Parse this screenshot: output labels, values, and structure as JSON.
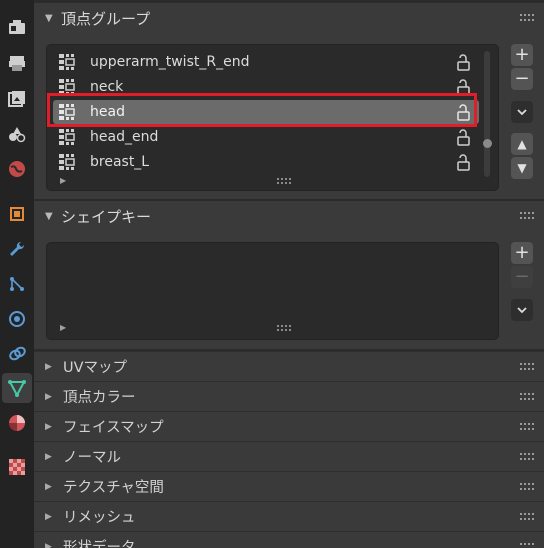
{
  "sidebar": {
    "tabs": [
      {
        "icon": "tool-icon",
        "active": false
      },
      {
        "icon": "render-icon",
        "active": false
      },
      {
        "icon": "output-icon",
        "active": false
      },
      {
        "icon": "view-layer-icon",
        "active": false
      },
      {
        "icon": "scene-icon",
        "active": false
      },
      {
        "icon": "world-icon",
        "active": false
      },
      {
        "icon": "object-icon",
        "active": false
      },
      {
        "icon": "modifier-wrench-icon",
        "active": false
      },
      {
        "icon": "particles-icon",
        "active": false
      },
      {
        "icon": "physics-icon",
        "active": false
      },
      {
        "icon": "constraints-icon",
        "active": false
      },
      {
        "icon": "object-data-icon",
        "active": true
      },
      {
        "icon": "material-icon",
        "active": false
      },
      {
        "icon": "texture-icon",
        "active": false
      }
    ]
  },
  "vertex_groups": {
    "title": "頂点グループ",
    "items": [
      {
        "name": "upperarm_twist_R_end",
        "selected": false
      },
      {
        "name": "neck",
        "selected": false
      },
      {
        "name": "head",
        "selected": true
      },
      {
        "name": "head_end",
        "selected": false
      },
      {
        "name": "breast_L",
        "selected": false
      }
    ],
    "add_label": "+",
    "remove_label": "−",
    "move_up_label": "▲",
    "move_down_label": "▼"
  },
  "shape_keys": {
    "title": "シェイプキー",
    "add_label": "+",
    "remove_label": "−"
  },
  "collapsed_panels": [
    {
      "title": "UVマップ"
    },
    {
      "title": "頂点カラー"
    },
    {
      "title": "フェイスマップ"
    },
    {
      "title": "ノーマル"
    },
    {
      "title": "テクスチャ空間"
    },
    {
      "title": "リメッシュ"
    },
    {
      "title": "形状データ"
    }
  ],
  "colors": {
    "highlight": "#e01e2a",
    "selected_row": "#6b6b6b",
    "active_tab_icon": "#45c9a6"
  }
}
